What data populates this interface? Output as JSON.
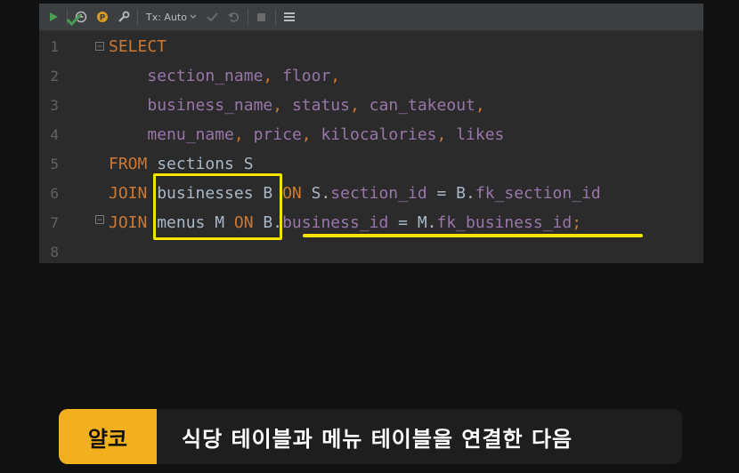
{
  "toolbar": {
    "tx_label": "Tx: Auto",
    "icons": [
      "run-icon",
      "history-icon",
      "profile-icon",
      "settings-icon",
      "transaction-dropdown",
      "commit-icon",
      "rollback-icon",
      "stop-icon",
      "table-icon"
    ]
  },
  "editor": {
    "line_numbers": [
      "1",
      "2",
      "3",
      "4",
      "5",
      "6",
      "7",
      "8"
    ],
    "lines": [
      [
        {
          "t": "SELECT",
          "c": "kw"
        }
      ],
      [
        {
          "t": "    ",
          "c": "id"
        },
        {
          "t": "section_name",
          "c": "col"
        },
        {
          "t": ", ",
          "c": "pun"
        },
        {
          "t": "floor",
          "c": "col"
        },
        {
          "t": ",",
          "c": "pun"
        }
      ],
      [
        {
          "t": "    ",
          "c": "id"
        },
        {
          "t": "business_name",
          "c": "col"
        },
        {
          "t": ", ",
          "c": "pun"
        },
        {
          "t": "status",
          "c": "col"
        },
        {
          "t": ", ",
          "c": "pun"
        },
        {
          "t": "can_takeout",
          "c": "col"
        },
        {
          "t": ",",
          "c": "pun"
        }
      ],
      [
        {
          "t": "    ",
          "c": "id"
        },
        {
          "t": "menu_name",
          "c": "col"
        },
        {
          "t": ", ",
          "c": "pun"
        },
        {
          "t": "price",
          "c": "col"
        },
        {
          "t": ", ",
          "c": "pun"
        },
        {
          "t": "kilocalories",
          "c": "col"
        },
        {
          "t": ", ",
          "c": "pun"
        },
        {
          "t": "likes",
          "c": "col"
        }
      ],
      [
        {
          "t": "FROM ",
          "c": "kw"
        },
        {
          "t": "sections S",
          "c": "tbl"
        }
      ],
      [
        {
          "t": "JOIN ",
          "c": "kw"
        },
        {
          "t": "businesses B ",
          "c": "tbl"
        },
        {
          "t": "ON ",
          "c": "kw"
        },
        {
          "t": "S.",
          "c": "id"
        },
        {
          "t": "section_id",
          "c": "col"
        },
        {
          "t": " = ",
          "c": "id"
        },
        {
          "t": "B.",
          "c": "id"
        },
        {
          "t": "fk_section_id",
          "c": "col"
        }
      ],
      [
        {
          "t": "JOIN ",
          "c": "kw"
        },
        {
          "t": "menus M ",
          "c": "tbl"
        },
        {
          "t": "ON ",
          "c": "kw"
        },
        {
          "t": "B.",
          "c": "id"
        },
        {
          "t": "business_id",
          "c": "col"
        },
        {
          "t": " = ",
          "c": "id"
        },
        {
          "t": "M.",
          "c": "id"
        },
        {
          "t": "fk_business_id",
          "c": "col"
        },
        {
          "t": ";",
          "c": "pun"
        }
      ],
      []
    ]
  },
  "subtitle": {
    "speaker": "얄코",
    "text": "식당 테이블과 메뉴 테이블을 연결한 다음"
  },
  "colors": {
    "highlight": "#f5e300",
    "speaker_bg": "#f2b01e",
    "keyword": "#cc7832",
    "column": "#9876aa"
  }
}
